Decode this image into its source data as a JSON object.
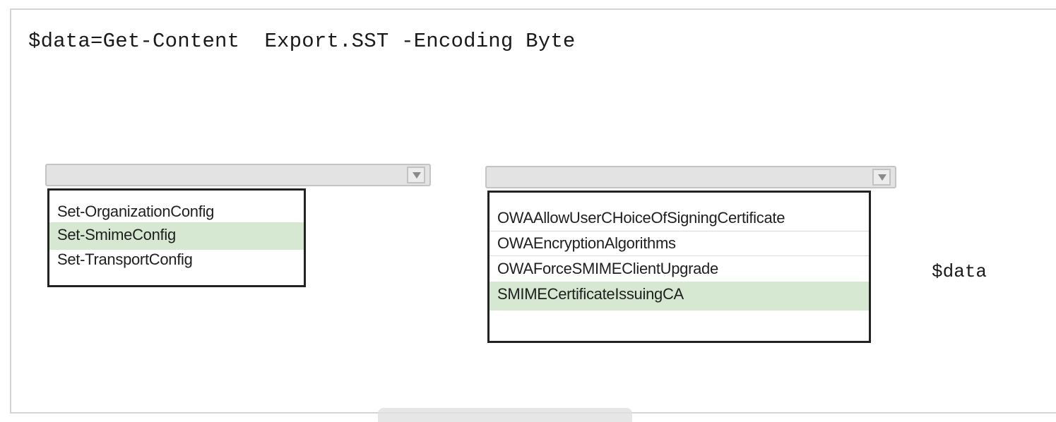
{
  "code": {
    "line": "$data=Get-Content  Export.SST -Encoding Byte",
    "variable": "$data"
  },
  "cmdlet_dropdown": {
    "selected_value": "",
    "options": [
      {
        "label": "Set-OrganizationConfig",
        "selected": false
      },
      {
        "label": "Set-SmimeConfig",
        "selected": true
      },
      {
        "label": "Set-TransportConfig",
        "selected": false
      }
    ]
  },
  "parameter_dropdown": {
    "selected_value": "",
    "options": [
      {
        "label": "OWAAllowUserCHoiceOfSigningCertificate",
        "selected": false
      },
      {
        "label": "OWAEncryptionAlgorithms",
        "selected": false
      },
      {
        "label": "OWAForceSMIMEClientUpgrade",
        "selected": false
      },
      {
        "label": "SMIMECertificateIssuingCA",
        "selected": true
      }
    ]
  },
  "colors": {
    "highlight": "#d6e8d2",
    "dropdown_bg": "#e3e3e3",
    "list_border": "#222222"
  },
  "icons": {
    "dropdown_arrow": "chevron-down-icon"
  }
}
